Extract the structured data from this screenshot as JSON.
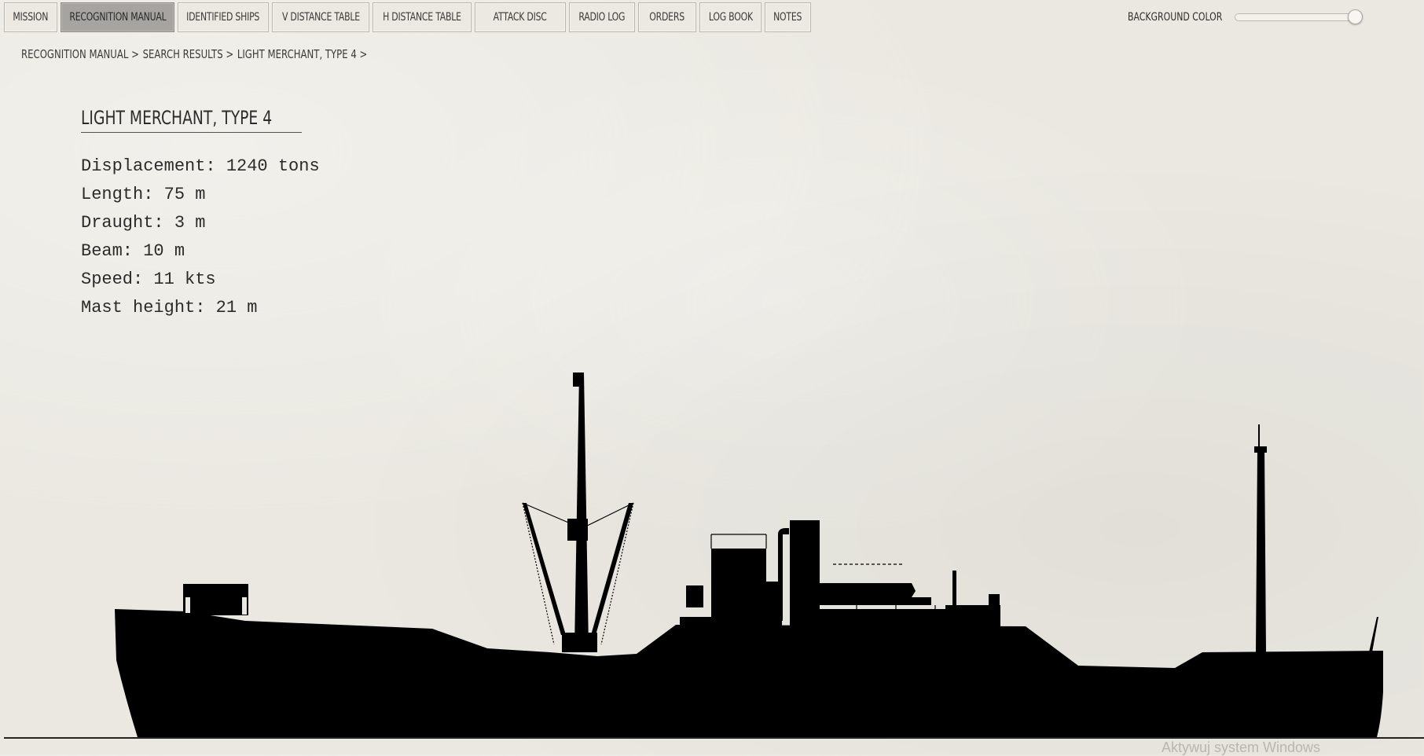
{
  "tabs": [
    {
      "label": "MISSION",
      "active": false
    },
    {
      "label": "RECOGNITION MANUAL",
      "active": true
    },
    {
      "label": "IDENTIFIED SHIPS",
      "active": false
    },
    {
      "label": "V DISTANCE TABLE",
      "active": false
    },
    {
      "label": "H DISTANCE TABLE",
      "active": false
    },
    {
      "label": "ATTACK DISC",
      "active": false
    },
    {
      "label": "RADIO LOG",
      "active": false
    },
    {
      "label": "ORDERS",
      "active": false
    },
    {
      "label": "LOG BOOK",
      "active": false
    },
    {
      "label": "NOTES",
      "active": false
    }
  ],
  "background_color": {
    "label": "BACKGROUND COLOR",
    "value": 1.0
  },
  "breadcrumb": [
    "RECOGNITION MANUAL >",
    "SEARCH RESULTS >",
    "LIGHT MERCHANT, TYPE 4 >"
  ],
  "ship": {
    "title": "LIGHT MERCHANT, TYPE 4",
    "specs": [
      "Displacement: 1240 tons",
      "Length: 75 m",
      "Draught: 3 m",
      "Beam: 10 m",
      "Speed: 11 kts",
      "Mast height: 21 m"
    ]
  },
  "watermark": "Aktywuj system Windows",
  "colors": {
    "silhouette": "#000000",
    "paper": "#eae8e1",
    "active_tab": "#a6a4a0"
  }
}
